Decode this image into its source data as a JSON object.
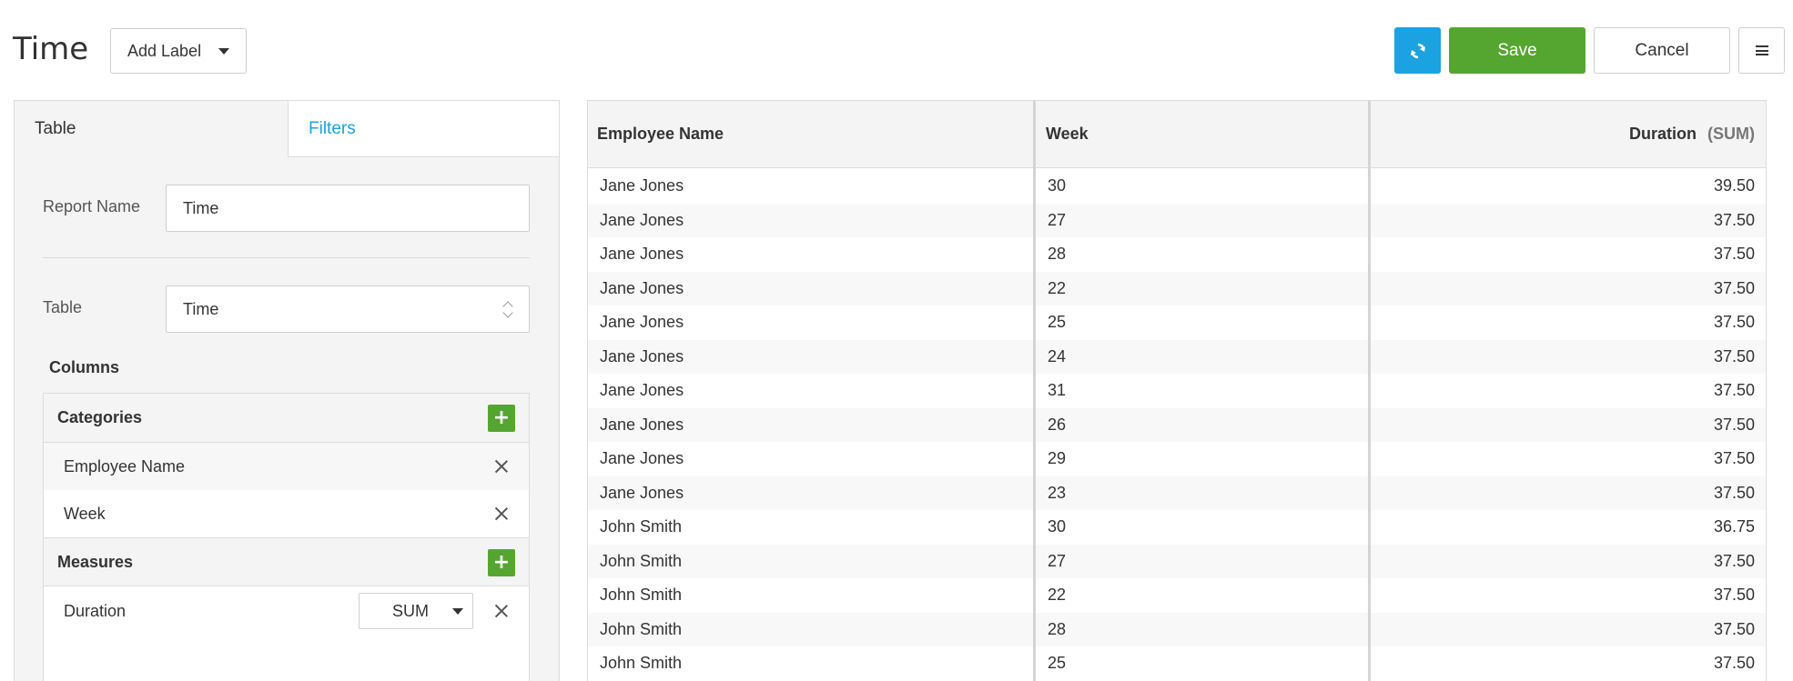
{
  "header": {
    "title": "Time",
    "add_label": "Add Label",
    "save_label": "Save",
    "cancel_label": "Cancel"
  },
  "tabs": [
    {
      "label": "Table",
      "active": false
    },
    {
      "label": "Filters",
      "active": true
    }
  ],
  "form": {
    "report_name_label": "Report Name",
    "report_name_value": "Time",
    "table_label": "Table",
    "table_value": "Time"
  },
  "columns": {
    "title": "Columns",
    "categories_title": "Categories",
    "categories": [
      "Employee Name",
      "Week"
    ],
    "measures_title": "Measures",
    "measures": [
      {
        "name": "Duration",
        "aggregation": "SUM"
      }
    ]
  },
  "table": {
    "headers": {
      "name": "Employee Name",
      "week": "Week",
      "duration": "Duration",
      "duration_agg": "(SUM)"
    },
    "rows": [
      {
        "name": "Jane Jones",
        "week": "30",
        "duration": "39.50"
      },
      {
        "name": "Jane Jones",
        "week": "27",
        "duration": "37.50"
      },
      {
        "name": "Jane Jones",
        "week": "28",
        "duration": "37.50"
      },
      {
        "name": "Jane Jones",
        "week": "22",
        "duration": "37.50"
      },
      {
        "name": "Jane Jones",
        "week": "25",
        "duration": "37.50"
      },
      {
        "name": "Jane Jones",
        "week": "24",
        "duration": "37.50"
      },
      {
        "name": "Jane Jones",
        "week": "31",
        "duration": "37.50"
      },
      {
        "name": "Jane Jones",
        "week": "26",
        "duration": "37.50"
      },
      {
        "name": "Jane Jones",
        "week": "29",
        "duration": "37.50"
      },
      {
        "name": "Jane Jones",
        "week": "23",
        "duration": "37.50"
      },
      {
        "name": "John Smith",
        "week": "30",
        "duration": "36.75"
      },
      {
        "name": "John Smith",
        "week": "27",
        "duration": "37.50"
      },
      {
        "name": "John Smith",
        "week": "22",
        "duration": "37.50"
      },
      {
        "name": "John Smith",
        "week": "28",
        "duration": "37.50"
      },
      {
        "name": "John Smith",
        "week": "25",
        "duration": "37.50"
      }
    ]
  },
  "colors": {
    "accent_blue": "#1aa3e0",
    "accent_green": "#55a630"
  },
  "icons": {
    "refresh": "refresh-icon",
    "menu": "hamburger-menu-icon",
    "add": "plus-icon",
    "remove": "close-icon"
  }
}
